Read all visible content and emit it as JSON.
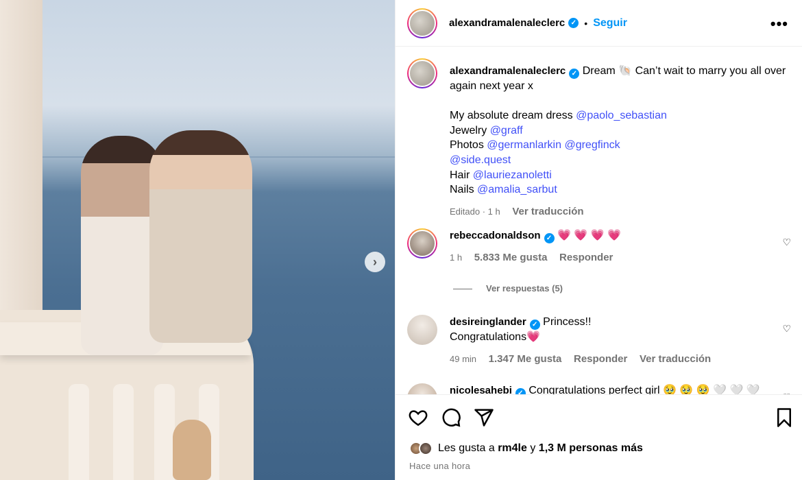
{
  "photo": {
    "next_icon": "chevron-right-icon",
    "next_glyph": "›"
  },
  "header": {
    "username": "alexandramalenaleclerc",
    "verified_glyph": "✓",
    "separator": "•",
    "follow_label": "Seguir",
    "more_glyph": "•••"
  },
  "caption": {
    "username": "alexandramalenaleclerc",
    "text_intro": "Dream",
    "shell_emoji": "🐚",
    "text_rest": "Can’t wait to marry you all over again next year x",
    "dress_label": "My absolute dream dress",
    "dress_mention": "@paolo_sebastian",
    "jewelry_label": "Jewelry",
    "jewelry_mention": "@graff",
    "photos_label": "Photos",
    "photos_mention_1": "@germanlarkin",
    "photos_mention_2": "@gregfinck",
    "photos_mention_3": "@side.quest",
    "hair_label": "Hair",
    "hair_mention": "@lauriezanoletti",
    "nails_label": "Nails",
    "nails_mention": "@amalia_sarbut",
    "edited": "Editado · 1 h",
    "translate": "Ver traducción"
  },
  "comments": [
    {
      "username": "rebeccadonaldson",
      "text": "💗 💗 💗 💗",
      "time": "1 h",
      "likes": "5.833 Me gusta",
      "reply": "Responder",
      "view_replies": "Ver respuestas (5)"
    },
    {
      "username": "desireinglander",
      "text_line1": "Princess!!",
      "text_line2": "Congratulations",
      "heart": "💗",
      "time": "49 min",
      "likes": "1.347 Me gusta",
      "reply": "Responder",
      "translate": "Ver traducción"
    },
    {
      "username": "nicolesahebi",
      "text": "Congratulations perfect girl 🥹 🥹 🥹 🤍 🤍 🤍"
    }
  ],
  "actions": {
    "like_icon": "heart-icon",
    "comment_icon": "comment-icon",
    "share_icon": "share-icon",
    "save_icon": "bookmark-icon",
    "likes_prefix": "Les gusta a",
    "likes_user": "rm4le",
    "likes_and": "y",
    "likes_rest": "1,3 M personas más",
    "timestamp": "Hace una hora"
  },
  "colors": {
    "accent": "#0095f6",
    "mention": "#4150f7",
    "muted": "#737373",
    "heart": "#ff3366"
  }
}
